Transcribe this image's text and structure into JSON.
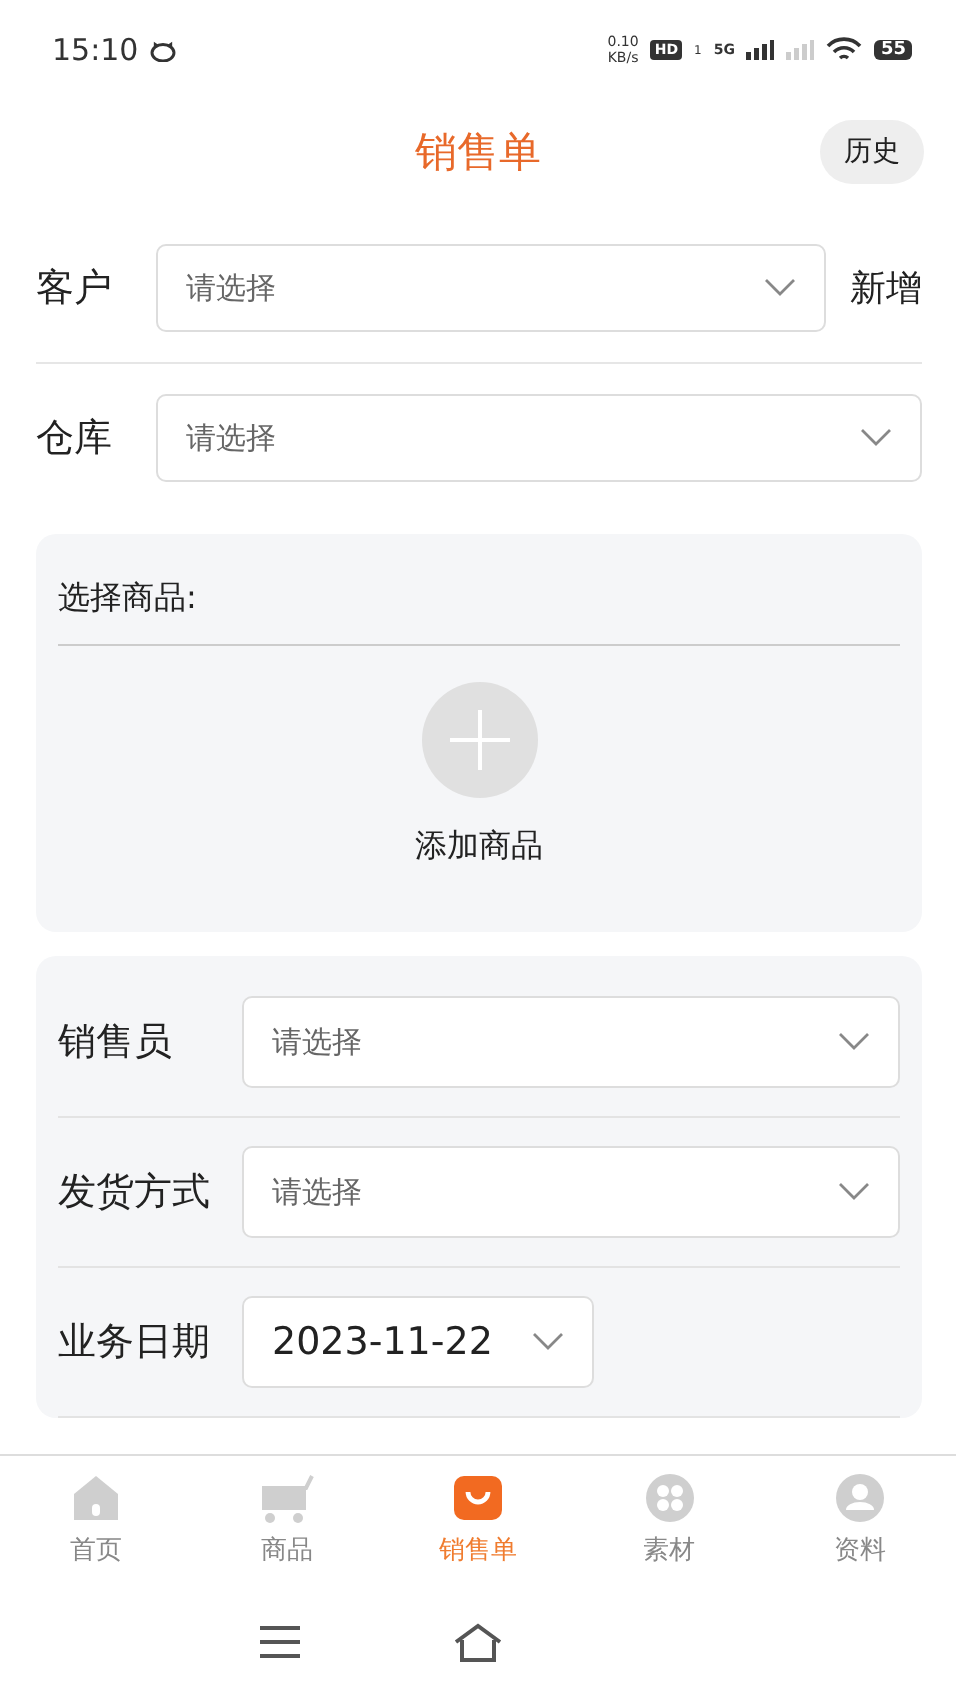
{
  "status_bar": {
    "time": "15:10",
    "speed_value": "0.10",
    "speed_unit": "KB/s",
    "hd": "HD",
    "sim": "1",
    "network": "5G",
    "battery": "55"
  },
  "header": {
    "title": "销售单",
    "history_button": "历史"
  },
  "customer": {
    "label": "客户",
    "placeholder": "请选择",
    "add_link": "新增"
  },
  "warehouse": {
    "label": "仓库",
    "placeholder": "请选择"
  },
  "products": {
    "title": "选择商品:",
    "add_label": "添加商品"
  },
  "details": [
    {
      "label": "销售员",
      "kind": "select",
      "placeholder": "请选择"
    },
    {
      "label": "发货方式",
      "kind": "select",
      "placeholder": "请选择"
    },
    {
      "label": "业务日期",
      "kind": "date",
      "value": "2023-11-22"
    }
  ],
  "tab_bar": [
    {
      "label": "首页",
      "selected": false
    },
    {
      "label": "商品",
      "selected": false
    },
    {
      "label": "销售单",
      "selected": true
    },
    {
      "label": "素材",
      "selected": false
    },
    {
      "label": "资料",
      "selected": false
    }
  ]
}
